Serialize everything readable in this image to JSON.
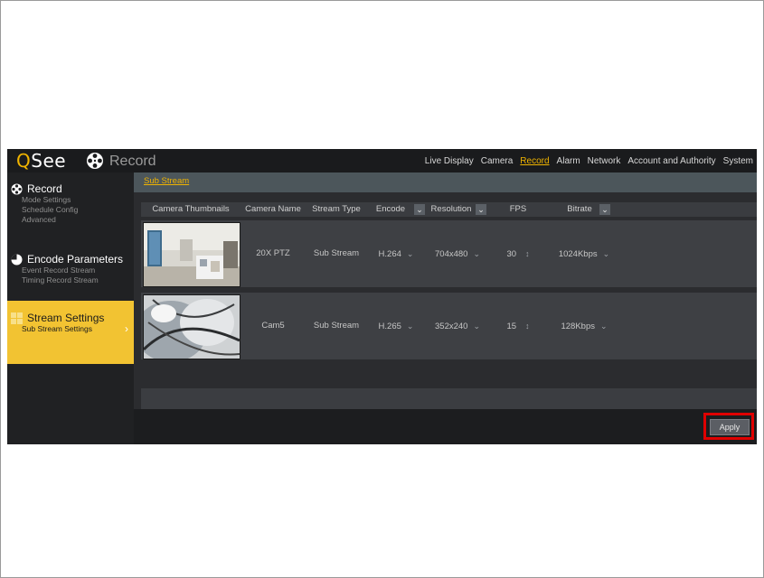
{
  "brand": {
    "logo_q": "Q",
    "logo_rest": "See"
  },
  "header": {
    "title": "Record",
    "nav": [
      "Live Display",
      "Camera",
      "Record",
      "Alarm",
      "Network",
      "Account and Authority",
      "System"
    ],
    "active_nav": "Record"
  },
  "sidebar": {
    "sections": [
      {
        "title": "Record",
        "items": [
          "Mode Settings",
          "Schedule Config",
          "Advanced"
        ]
      },
      {
        "title": "Encode Parameters",
        "items": [
          "Event Record Stream",
          "Timing Record Stream"
        ]
      },
      {
        "title": "Stream Settings",
        "items": [
          "Sub Stream Settings"
        ],
        "active": true
      }
    ]
  },
  "content": {
    "tab": "Sub Stream",
    "columns": [
      "Camera Thumbnails",
      "Camera Name",
      "Stream Type",
      "Encode",
      "Resolution",
      "FPS",
      "Bitrate"
    ],
    "rows": [
      {
        "camera_name": "20X PTZ",
        "stream_type": "Sub Stream",
        "encode": "H.264",
        "resolution": "704x480",
        "fps": "30",
        "bitrate": "1024Kbps"
      },
      {
        "camera_name": "Cam5",
        "stream_type": "Sub Stream",
        "encode": "H.265",
        "resolution": "352x240",
        "fps": "15",
        "bitrate": "128Kbps"
      }
    ],
    "apply_label": "Apply"
  },
  "colors": {
    "accent": "#f0b400",
    "active_section": "#f2c332",
    "highlight": "#e00000"
  },
  "icons": [
    "film-reel-icon",
    "palette-icon",
    "grid-icon",
    "chevron-right-icon",
    "chevron-down-icon",
    "spinner-arrows-icon"
  ]
}
